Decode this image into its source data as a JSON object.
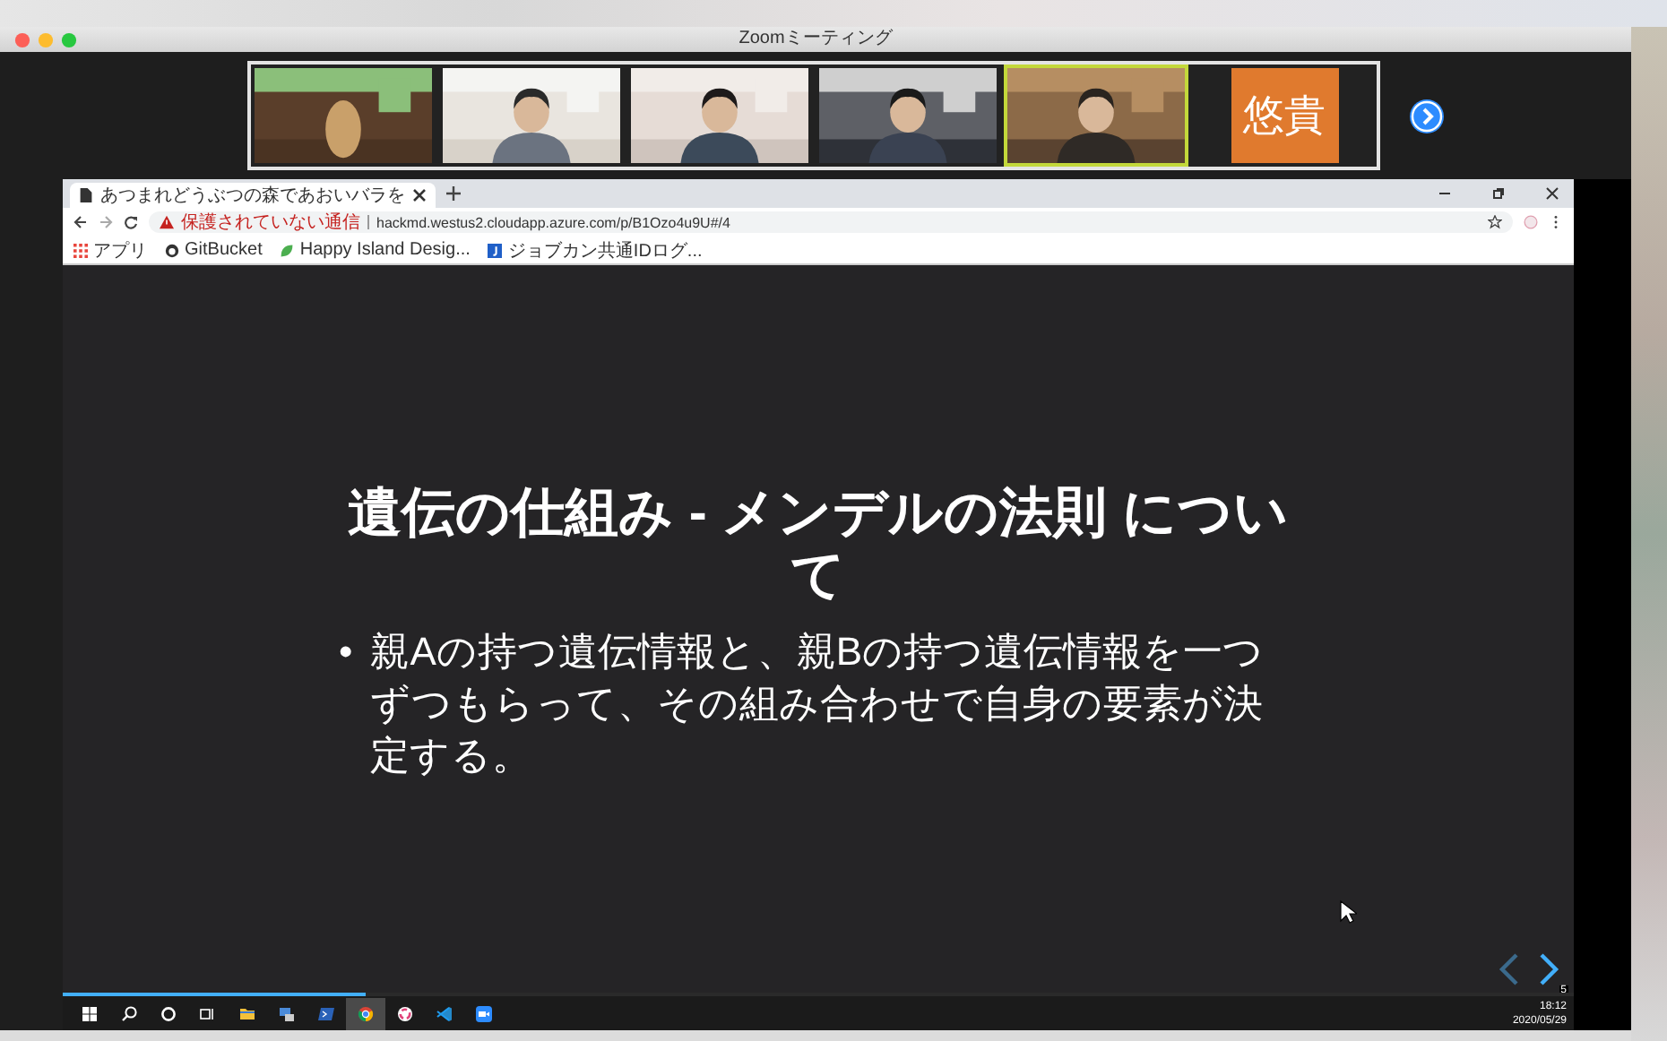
{
  "window": {
    "title": "Zoomミーティング"
  },
  "participants": [
    {
      "kind": "video",
      "active": false
    },
    {
      "kind": "video",
      "active": false
    },
    {
      "kind": "video",
      "active": false
    },
    {
      "kind": "video",
      "active": false
    },
    {
      "kind": "video",
      "active": true
    },
    {
      "kind": "name",
      "name": "悠貴",
      "active": false
    }
  ],
  "browser": {
    "tab_title": "あつまれどうぶつの森であおいバラを",
    "security": "保護されていない通信",
    "url": "hackmd.westus2.cloudapp.azure.com/p/B1Ozo4u9U#/4",
    "bookmarks": [
      {
        "kind": "apps",
        "label": "アプリ"
      },
      {
        "kind": "git",
        "label": "GitBucket"
      },
      {
        "kind": "leaf",
        "label": "Happy Island Desig..."
      },
      {
        "kind": "job",
        "label": "ジョブカン共通IDログ..."
      }
    ]
  },
  "slide": {
    "title": "遺伝の仕組み - メンデルの法則 について",
    "bullets": [
      {
        "marker": "•",
        "text": "親Aの持つ遺伝情報と、親Bの持つ遺伝情報を一つずつもらって、その組み合わせで自身の要素が決定する。"
      }
    ],
    "number": "5",
    "progress": {
      "level": 0.2
    }
  },
  "taskbar": {
    "time": "18:12",
    "date": "2020/05/29"
  }
}
